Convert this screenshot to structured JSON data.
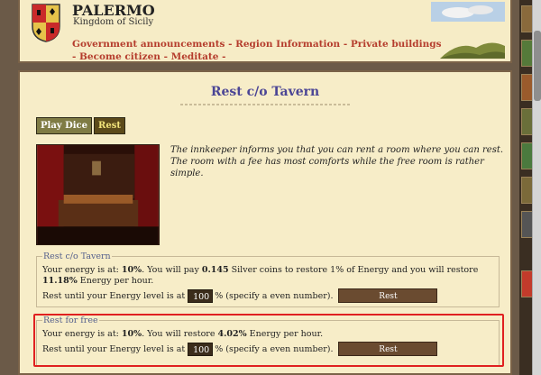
{
  "header": {
    "town": "PALERMO",
    "kingdom": "Kingdom of Sicily",
    "nav": {
      "government": "Government announcements",
      "region": "Region Information",
      "private": "Private buildings",
      "citizen": "Become citizen",
      "meditate": "Meditate",
      "separator": "-"
    }
  },
  "page": {
    "title": "Rest c/o Tavern",
    "tabs": {
      "dice": "Play Dice",
      "rest": "Rest"
    },
    "intro": "The innkeeper informs you that you can rent a room where you can rest. The room with a fee has most comforts while the free room is rather simple."
  },
  "paid_rest": {
    "legend": "Rest c/o Tavern",
    "energy_prefix": "Your energy is at: ",
    "energy_value": "10%",
    "pay_prefix": ". You will pay ",
    "cost": "0.145",
    "pay_suffix": " Silver coins to restore 1% of Energy and you will restore ",
    "restore": "11.18%",
    "restore_suffix": " Energy per hour.",
    "until_label": "Rest until your Energy level is at",
    "until_value": "100",
    "until_suffix": "% (specify a even number).",
    "button": "Rest"
  },
  "free_rest": {
    "legend": "Rest for free",
    "energy_prefix": "Your energy is at: ",
    "energy_value": "10%",
    "restore_prefix": ". You will restore ",
    "restore": "4.02%",
    "restore_suffix": " Energy per hour.",
    "until_label": "Rest until your Energy level is at",
    "until_value": "100",
    "until_suffix": "% (specify a even number).",
    "button": "Rest"
  },
  "colors": {
    "parchment": "#f7edc8",
    "title": "#4b4595",
    "nav_link": "#b53d2d",
    "highlight": "#e02020"
  }
}
